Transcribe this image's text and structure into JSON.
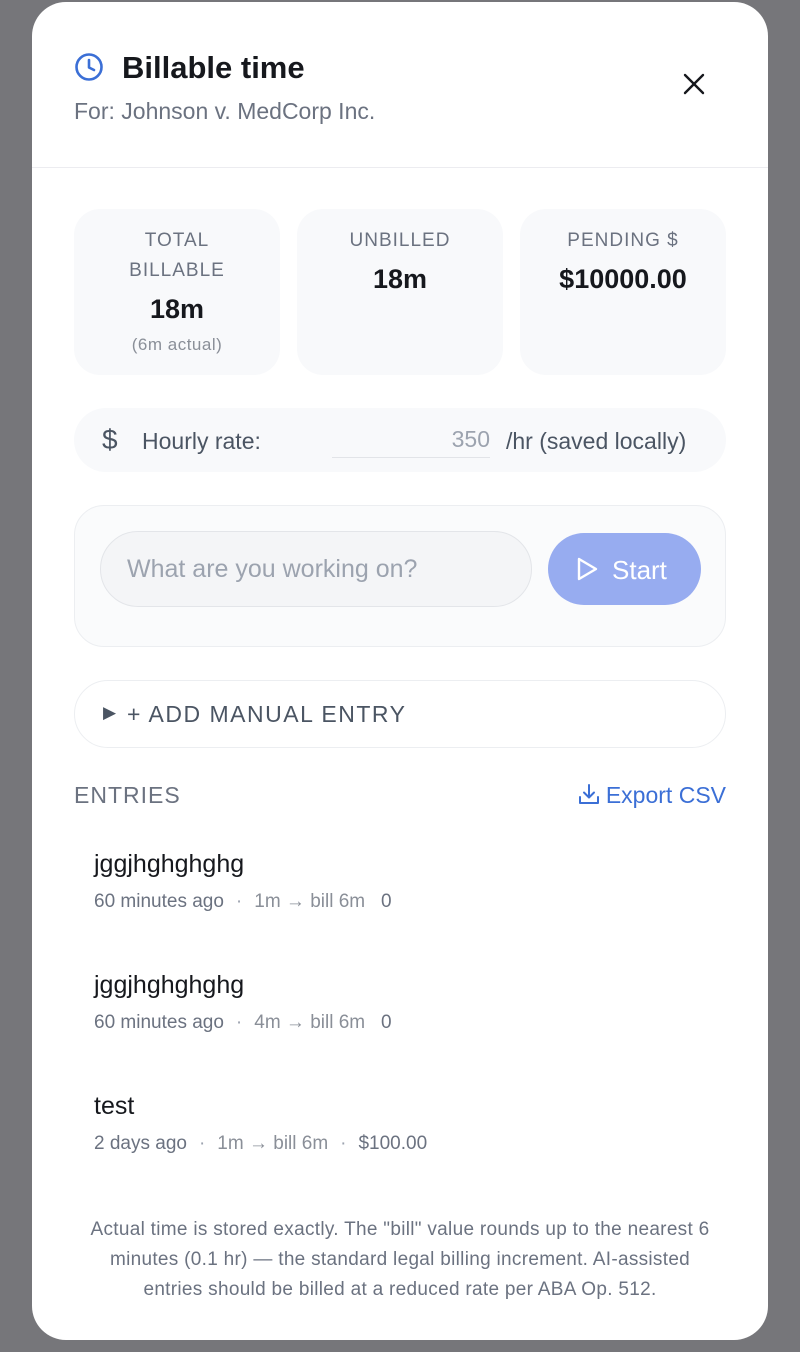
{
  "header": {
    "icon": "clock-icon",
    "title": "Billable time",
    "subtitle": "For: Johnson v. MedCorp Inc.",
    "accent_color": "#3b6fd6"
  },
  "stats": [
    {
      "label": "TOTAL BILLABLE",
      "value": "18m",
      "sub": "(6m actual)"
    },
    {
      "label": "UNBILLED",
      "value": "18m",
      "sub": ""
    },
    {
      "label": "PENDING $",
      "value": "$10000.00",
      "sub": ""
    }
  ],
  "rate": {
    "icon": "dollar-icon",
    "label": "Hourly rate:",
    "value": "350",
    "suffix": "/hr (saved locally)"
  },
  "timer": {
    "placeholder": "What are you working on?",
    "start_label": "Start",
    "start_color": "#97acf0"
  },
  "manual_entry": {
    "label": "+ ADD MANUAL ENTRY"
  },
  "entries_section": {
    "heading": "ENTRIES",
    "export_label": "Export CSV"
  },
  "entries": [
    {
      "title": "jggjhghghghg",
      "time": "60 minutes ago",
      "duration": "1m → bill 6m",
      "amount": "0"
    },
    {
      "title": "jggjhghghghg",
      "time": "60 minutes ago",
      "duration": "4m → bill 6m",
      "amount": "0"
    },
    {
      "title": "test",
      "time": "2 days ago",
      "duration": "1m → bill 6m",
      "amount": "$100.00"
    }
  ],
  "footnote": "Actual time is stored exactly. The \"bill\" value rounds up to the nearest 6 minutes (0.1 hr) — the standard legal billing increment. AI-assisted entries should be billed at a reduced rate per ABA Op. 512."
}
